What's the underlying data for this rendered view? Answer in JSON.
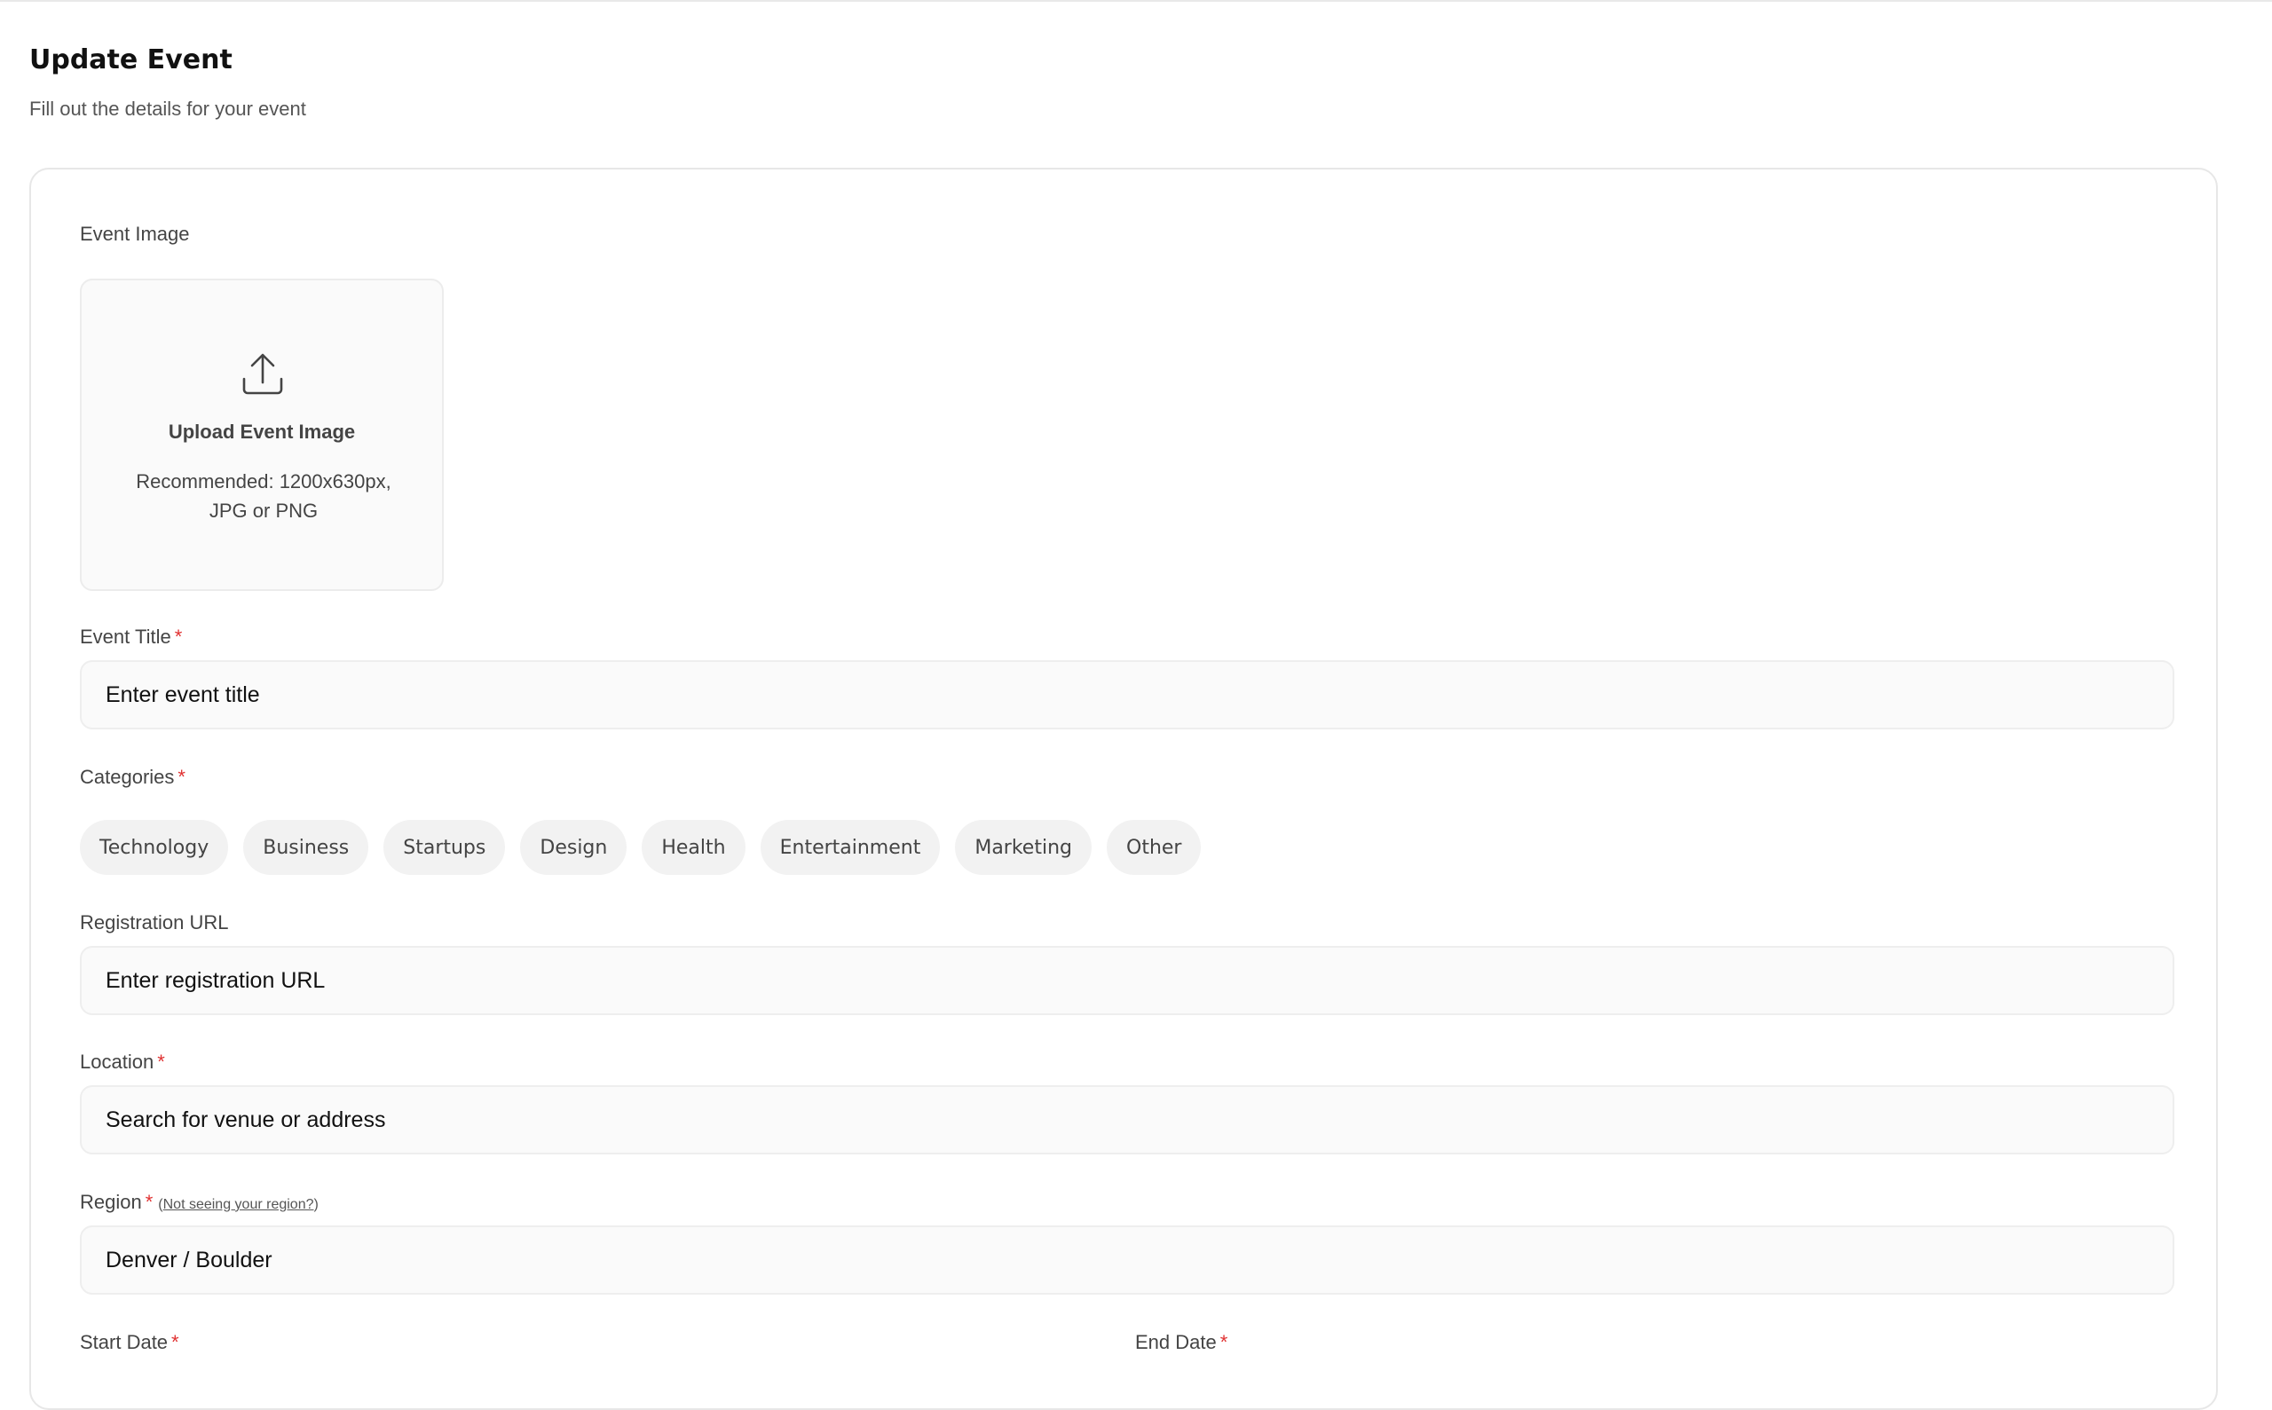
{
  "header": {
    "title": "Update Event",
    "subtitle": "Fill out the details for your event"
  },
  "form": {
    "event_image": {
      "label": "Event Image",
      "upload_title": "Upload Event Image",
      "upload_hint": "Recommended: 1200x630px, JPG or PNG",
      "icon": "upload-icon"
    },
    "event_title": {
      "label": "Event Title",
      "required_mark": "*",
      "placeholder": "Enter event title"
    },
    "categories": {
      "label": "Categories",
      "required_mark": "*",
      "options": [
        "Technology",
        "Business",
        "Startups",
        "Design",
        "Health",
        "Entertainment",
        "Marketing",
        "Other"
      ]
    },
    "registration_url": {
      "label": "Registration URL",
      "placeholder": "Enter registration URL"
    },
    "location": {
      "label": "Location",
      "required_mark": "*",
      "placeholder": "Search for venue or address"
    },
    "region": {
      "label": "Region",
      "required_mark": "*",
      "help_open": "(",
      "help_link": "Not seeing your region?",
      "help_close": ")",
      "value": "Denver / Boulder"
    },
    "start_date": {
      "label": "Start Date",
      "required_mark": "*"
    },
    "end_date": {
      "label": "End Date",
      "required_mark": "*"
    }
  },
  "colors": {
    "required": "#e03131",
    "input_background": "#fafafa",
    "chip_background": "#f2f2f2"
  }
}
